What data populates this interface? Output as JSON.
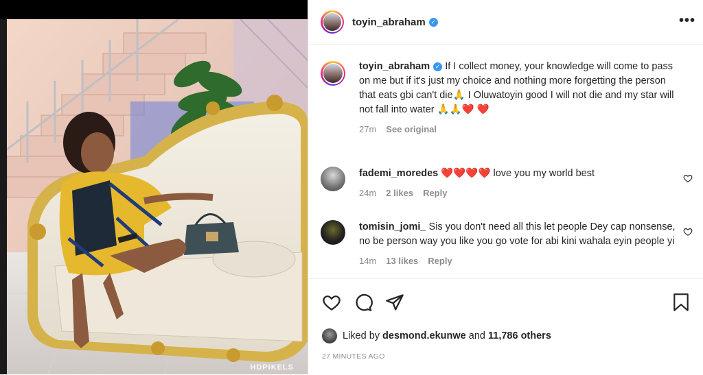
{
  "post": {
    "username": "toyin_abraham",
    "watermark": "HDPIKELS"
  },
  "caption": {
    "username": "toyin_abraham",
    "text": "If I collect money, your knowledge will come to pass on me but if it's just my choice and nothing more forgetting the person that eats gbi can't die🙏 I Oluwatoyin good I will not die and my star will not fall into water 🙏🙏❤️ ❤️",
    "time": "27m",
    "see_original": "See original"
  },
  "comments": [
    {
      "username": "fademi_moredes",
      "text": "❤️❤️❤️❤️ love you my world best",
      "time": "24m",
      "likes": "2 likes",
      "reply": "Reply"
    },
    {
      "username": "tomisin_jomi_",
      "text": "Sis you don't need all this let people Dey cap nonsense, no be person way you like you go vote for abi kini wahala eyin people yi",
      "time": "14m",
      "likes": "13 likes",
      "reply": "Reply"
    }
  ],
  "likes": {
    "prefix": "Liked by",
    "user": "desmond.ekunwe",
    "middle": "and",
    "others": "11,786 others"
  },
  "timestamp": "27 MINUTES AGO",
  "icons": [
    "heart-icon",
    "comment-icon",
    "share-icon",
    "bookmark-icon",
    "more-icon",
    "verified-icon"
  ],
  "colors": {
    "verified": "#3897f0",
    "meta": "#8e8e8e",
    "text": "#262626"
  }
}
